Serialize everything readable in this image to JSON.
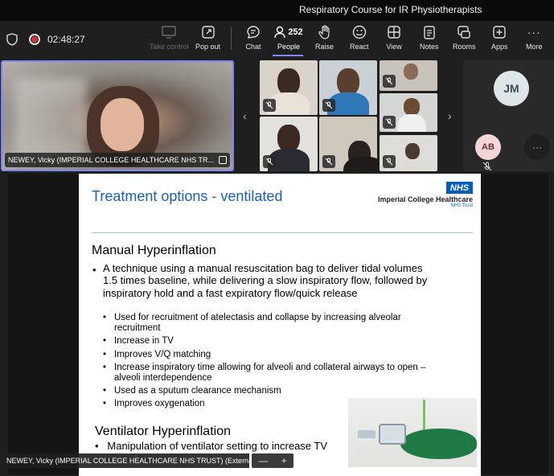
{
  "window": {
    "title": "Respiratory Course for IR Physiotherapists"
  },
  "toolbar": {
    "timer": "02:48:27",
    "buttons": {
      "take_control": "Take control",
      "pop_out": "Pop out",
      "chat": "Chat",
      "people": "People",
      "people_count": "252",
      "raise": "Raise",
      "react": "React",
      "view": "View",
      "notes": "Notes",
      "rooms": "Rooms",
      "apps": "Apps",
      "more": "More"
    }
  },
  "gallery": {
    "main_speaker": "NEWEY, Vicky (IMPERIAL COLLEGE HEALTHCARE NHS TR...",
    "avatars": {
      "jm": "JM",
      "ab": "AB"
    }
  },
  "slide": {
    "title": "Treatment options - ventilated",
    "logo": "NHS",
    "org_name": "Imperial College Healthcare",
    "org_sub": "NHS Trust",
    "section1": "Manual Hyperinflation",
    "main_point": "A technique using a manual resuscitation bag to deliver tidal volumes 1.5 times baseline, while delivering a slow inspiratory flow, followed by inspiratory hold and a fast expiratory flow/quick release",
    "sub_points": [
      "Used for recruitment of atelectasis and collapse by increasing alveolar recruitment",
      "Increase in TV",
      "Improves V/Q matching",
      "Increase inspiratory time allowing for alveoli and collateral airways to open – alveoli interdependence",
      "Used as a sputum clearance mechanism",
      "Improves oxygenation"
    ],
    "section2": "Ventilator Hyperinflation",
    "section2_point": "Manipulation of ventilator setting to increase TV"
  },
  "stage": {
    "presenter_tag": "NEWEY, Vicky (IMPERIAL COLLEGE HEALTHCARE NHS TRUST) (External)",
    "zoom_out": "—",
    "zoom_in": "+"
  },
  "colors": {
    "accent": "#7f85f5",
    "nhs_blue": "#005eb8",
    "slide_title": "#1f5fa8",
    "record": "#d13438"
  }
}
